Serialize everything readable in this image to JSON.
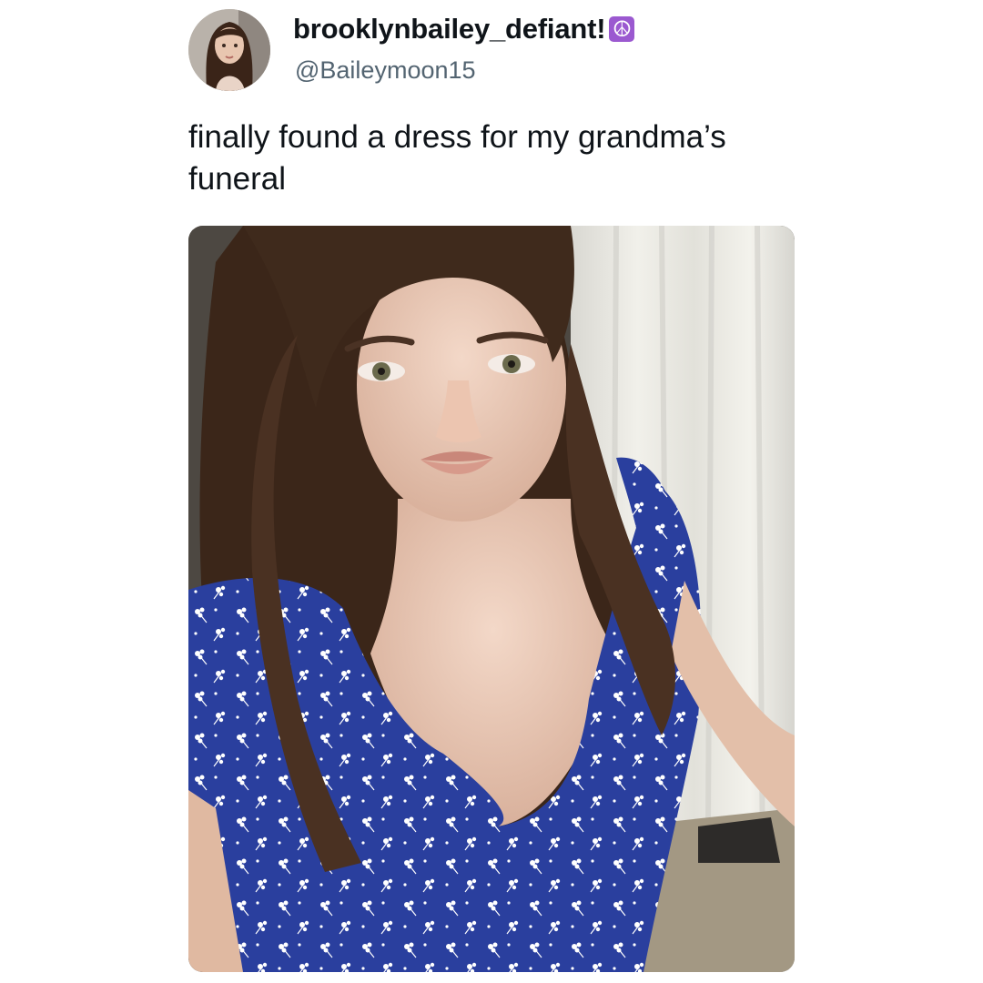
{
  "tweet": {
    "display_name": "brooklynbailey_defiant!",
    "badge_icon": "peace-symbol-icon",
    "badge_glyph": "☮",
    "badge_color": "#9b59d0",
    "handle": "@Baileymoon15",
    "text": "finally found a dress for my grandma’s funeral"
  },
  "colors": {
    "name": "#0f1419",
    "handle": "#536471",
    "dress": "#2a3f9e"
  }
}
